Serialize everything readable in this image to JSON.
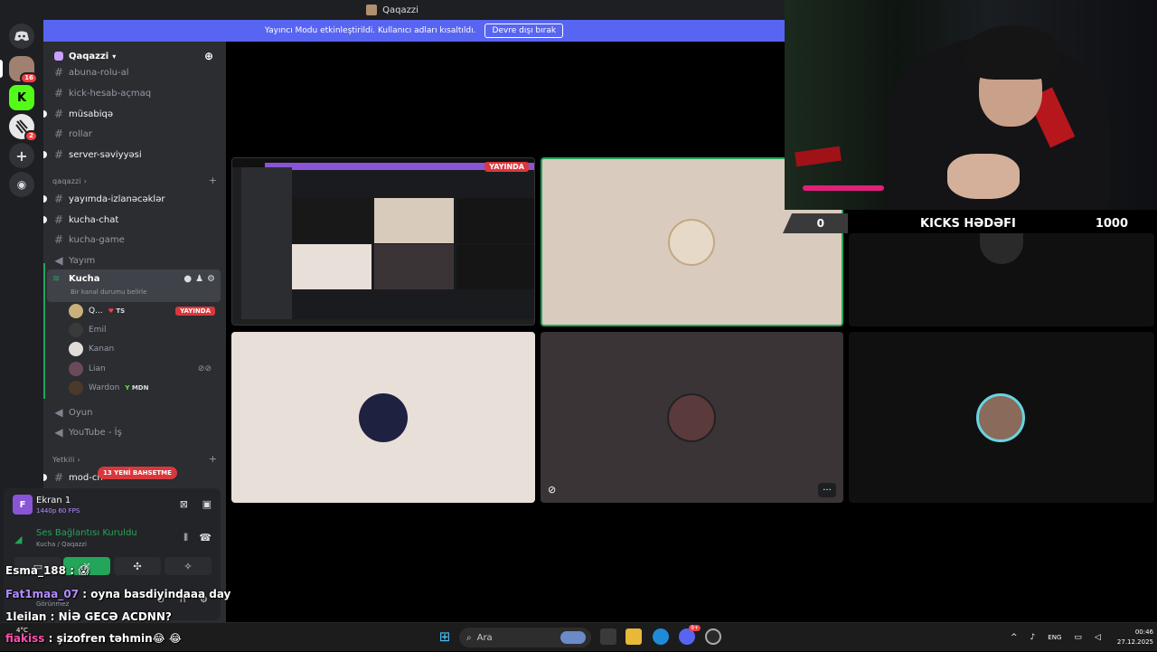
{
  "window": {
    "title": "Qaqazzi"
  },
  "banner": {
    "message": "Yayıncı Modu etkinleştirildi. Kullanıcı adları kısaltıldı.",
    "button": "Devre dışı bırak"
  },
  "rail": {
    "badges": [
      "16",
      "2"
    ],
    "icons": [
      "discord-logo",
      "server-avatar",
      "kick-logo",
      "zebra-avatar",
      "add-server",
      "explore"
    ]
  },
  "server": {
    "name": "Qaqazzi"
  },
  "channels_top": [
    {
      "name": "abuna-rolu-al"
    },
    {
      "name": "kick-hesab-açmaq"
    },
    {
      "name": "müsabiqə"
    },
    {
      "name": "rollar"
    },
    {
      "name": "server-səviyyəsi"
    }
  ],
  "category_qaqazzi": "qaqazzi",
  "channels_mid": [
    {
      "name": "yayımda-izlanəcəklər"
    },
    {
      "name": "kucha-chat"
    },
    {
      "name": "kucha-game"
    },
    {
      "name": "Yayım"
    }
  ],
  "voice_channel": {
    "name": "Kucha",
    "status": "Bir kanal durumu belirle",
    "users": [
      {
        "name": "Q...",
        "tag": "TS",
        "live": "YAYINDA"
      },
      {
        "name": "Emil"
      },
      {
        "name": "Kanan"
      },
      {
        "name": "Lian"
      },
      {
        "name": "Wardon",
        "tag": "MDN"
      }
    ]
  },
  "channels_bottom": [
    {
      "name": "Oyun"
    },
    {
      "name": "YouTube - İş"
    }
  ],
  "category_yetkili": "Yetkili",
  "channel_mod": "mod-ch",
  "new_mentions": "13 YENİ BAHSETME",
  "panel": {
    "screen_name": "Ekran 1",
    "screen_quality": "1440p 60 FPS",
    "voice_status": "Ses Bağlantısı Kuruldu",
    "voice_location": "Kucha / Qaqazzi",
    "user_status": "Görünmez"
  },
  "stream_tile": {
    "live": "YAYINDA"
  },
  "goal": {
    "current": "0",
    "title": "KICKS HƏDƏFI",
    "target": "1000"
  },
  "chat": [
    {
      "user": "Esma_188",
      "sep": ":",
      "text": "😱",
      "color": "#ffffff"
    },
    {
      "user": "Fat1maa_07",
      "sep": ":",
      "text": "oyna basdiyindaaa day",
      "color": "#b48cff"
    },
    {
      "user": "1leilan",
      "sep": ":",
      "text": "NİƏ GECƏ ACDNN?",
      "color": "#ffffff"
    },
    {
      "user": "fiakiss",
      "sep": ":",
      "text": "şizofren təhmin😂 😂",
      "color": "#ff4fb0"
    }
  ],
  "taskbar": {
    "search": "Ara",
    "weather": "4°C",
    "lang": "ENG",
    "time": "00:46",
    "date": "27.12.2025",
    "discord_badge": "9+"
  }
}
